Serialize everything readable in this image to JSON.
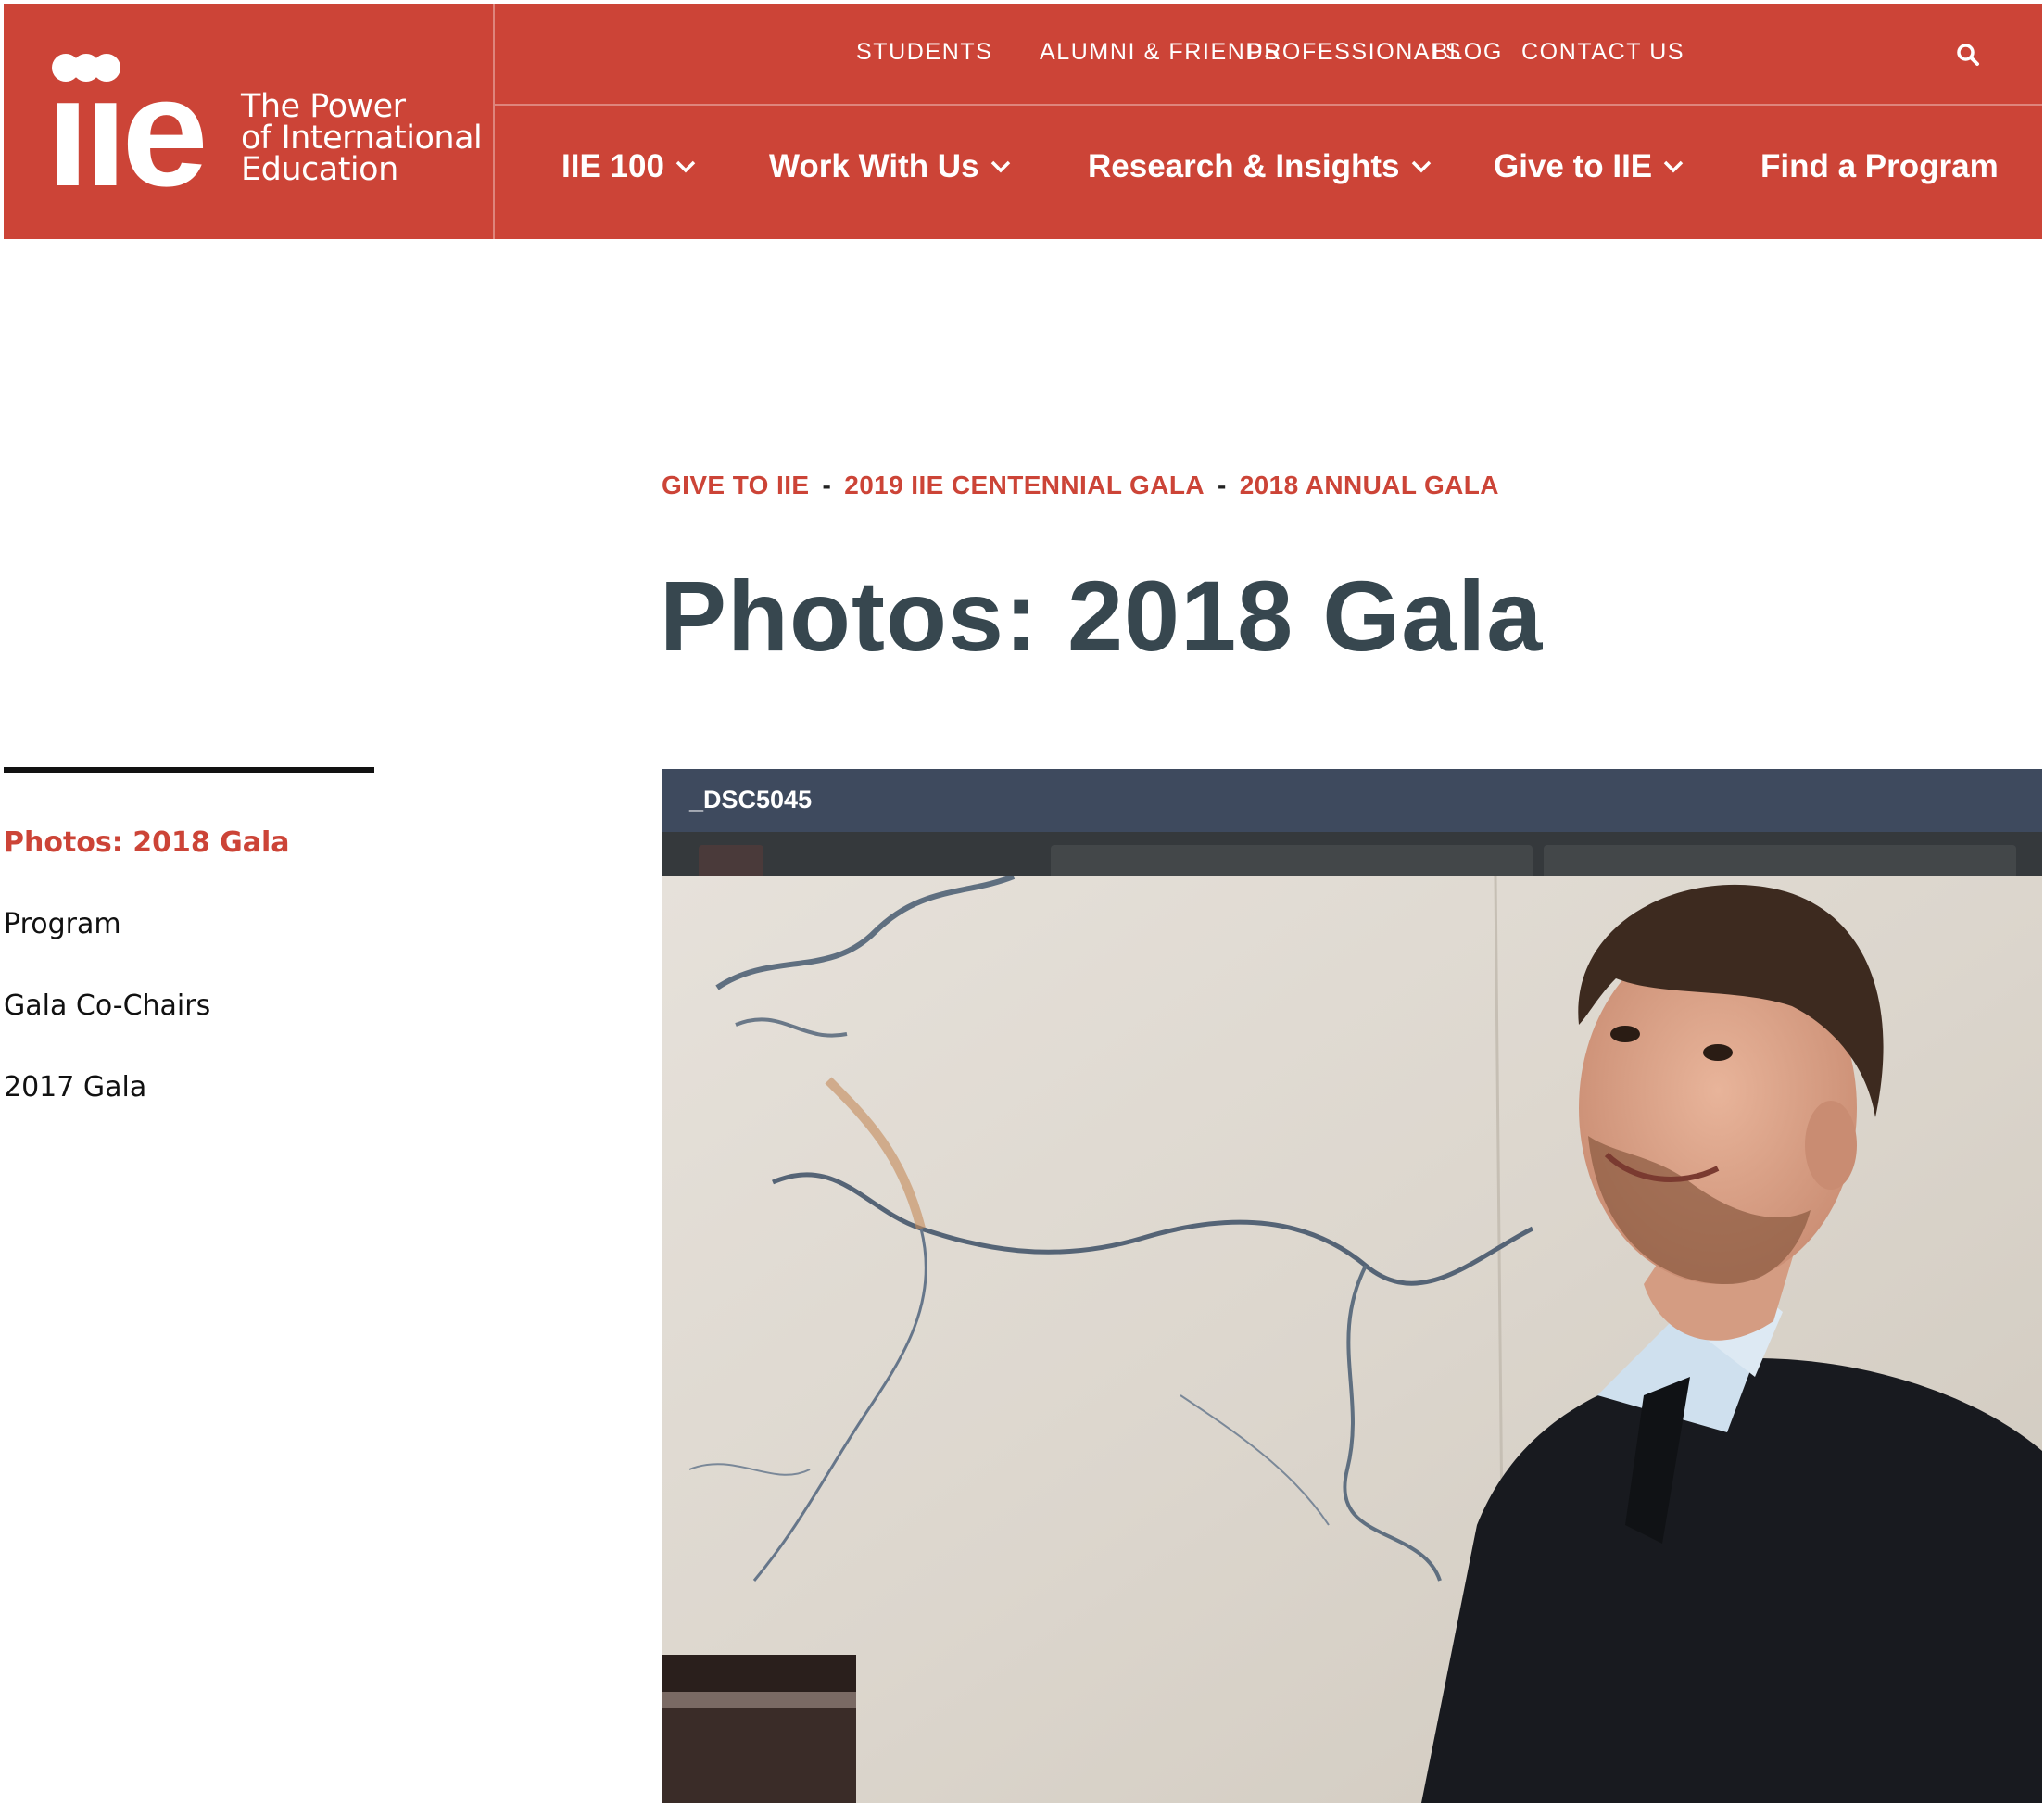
{
  "brand": {
    "logo_text": "iie",
    "tagline": [
      "The Power",
      "of International",
      "Education"
    ],
    "color": "#cc4437"
  },
  "utility_nav": [
    "STUDENTS",
    "ALUMNI & FRIENDS",
    "PROFESSIONALS",
    "BLOG",
    "CONTACT US"
  ],
  "main_nav": [
    {
      "label": "IIE 100",
      "dropdown": true
    },
    {
      "label": "Work With Us",
      "dropdown": true
    },
    {
      "label": "Research & Insights",
      "dropdown": true
    },
    {
      "label": "Give to IIE",
      "dropdown": true
    },
    {
      "label": "Find a Program",
      "dropdown": false
    }
  ],
  "breadcrumb": [
    "GIVE TO IIE",
    "2019 IIE CENTENNIAL GALA",
    "2018 ANNUAL GALA"
  ],
  "breadcrumb_sep": "-",
  "page_title": "Photos: 2018 Gala",
  "sidebar": [
    {
      "label": "Photos: 2018 Gala",
      "active": true
    },
    {
      "label": "Program",
      "active": false
    },
    {
      "label": "Gala Co-Chairs",
      "active": false
    },
    {
      "label": "2017 Gala",
      "active": false
    }
  ],
  "gallery": {
    "caption": "_DSC5045"
  }
}
